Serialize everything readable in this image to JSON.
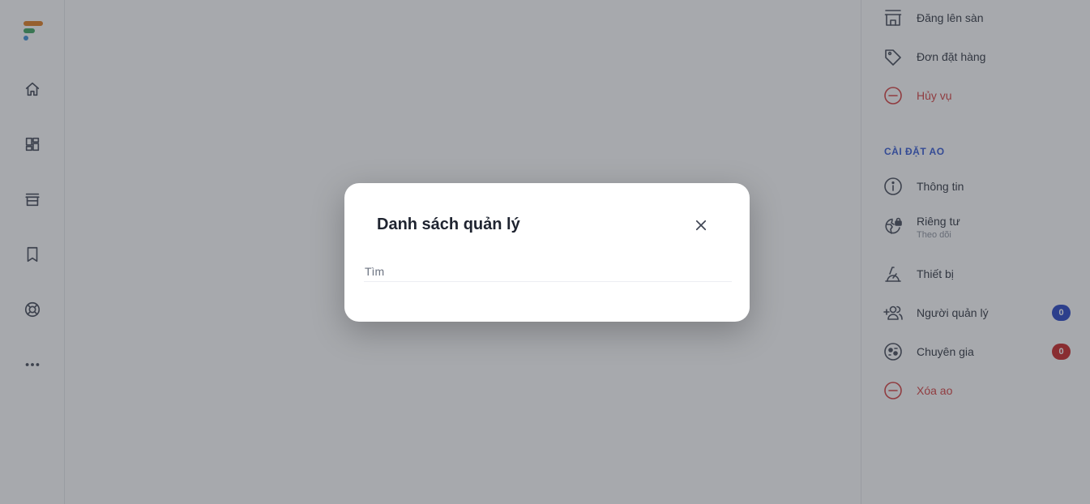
{
  "rail": {
    "items": [
      {
        "icon": "home-icon"
      },
      {
        "icon": "dashboard-icon"
      },
      {
        "icon": "store-icon"
      },
      {
        "icon": "bookmark-icon"
      },
      {
        "icon": "support-icon"
      },
      {
        "icon": "more-icon"
      }
    ]
  },
  "right_panel": {
    "items_top": [
      {
        "label": "Đăng lên sàn",
        "icon": "store-icon"
      },
      {
        "label": "Đơn đặt hàng",
        "icon": "tag-icon"
      },
      {
        "label": "Hủy vụ",
        "icon": "minus-circle-icon"
      }
    ],
    "section_title": "CÀI ĐẶT AO",
    "items": [
      {
        "label": "Thông tin",
        "icon": "info-icon"
      },
      {
        "label": "Riêng tư",
        "sublabel": "Theo dõi",
        "icon": "globe-lock-icon"
      },
      {
        "label": "Thiết bị",
        "icon": "device-icon"
      },
      {
        "label": "Người quản lý",
        "icon": "add-user-icon",
        "badge": "0"
      },
      {
        "label": "Chuyên gia",
        "icon": "expert-icon",
        "badge": "0"
      },
      {
        "label": "Xóa ao",
        "icon": "minus-circle-icon"
      }
    ],
    "colors": {
      "section": "#2f55d4",
      "danger": "#d63a3a",
      "badge_blue": "#1f3fc4",
      "badge_red": "#c81e1e"
    }
  },
  "modal": {
    "title": "Danh sách quản lý",
    "search_placeholder": "Tìm",
    "search_value": ""
  }
}
